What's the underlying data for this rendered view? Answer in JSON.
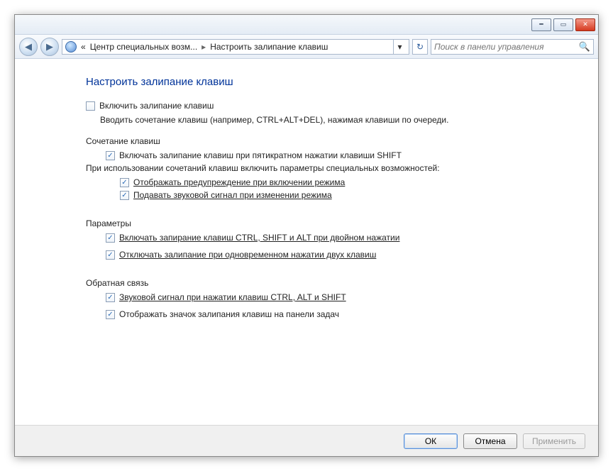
{
  "window": {
    "minimize_glyph": "━",
    "maximize_glyph": "▭",
    "close_glyph": "✕"
  },
  "nav": {
    "back_glyph": "◀",
    "forward_glyph": "▶",
    "crumb_prefix": "«",
    "crumb1": "Центр специальных возм...",
    "crumb2": "Настроить залипание клавиш",
    "sep": "▸",
    "dropdown_glyph": "▾",
    "refresh_glyph": "↻",
    "search_placeholder": "Поиск в панели управления",
    "search_glyph": "🔍"
  },
  "page": {
    "title": "Настроить залипание клавиш",
    "enable_label": "Включить залипание клавиш",
    "enable_desc": "Вводить сочетание клавиш (например, CTRL+ALT+DEL), нажимая клавиши по очереди.",
    "section_shortcut": "Сочетание клавиш",
    "shortcut_enable": "Включать залипание клавиш при пятикратном нажатии клавиши SHIFT",
    "shortcut_note": "При использовании сочетаний клавиш включить параметры специальных возможностей:",
    "show_warning": "Отображать предупреждение при включении режима",
    "play_sound": "Подавать звуковой сигнал при изменении режима",
    "section_params": "Параметры",
    "lock_modifier": "Включать запирание клавиш CTRL, SHIFT и ALT при двойном нажатии",
    "turn_off_two": "Отключать залипание при одновременном нажатии двух клавиш",
    "section_feedback": "Обратная связь",
    "beep_modifier": "Звуковой сигнал при нажатии клавиш CTRL, ALT и SHIFT",
    "show_tray_icon": "Отображать значок залипания клавиш на панели задач"
  },
  "buttons": {
    "ok": "ОК",
    "cancel": "Отмена",
    "apply": "Применить"
  },
  "checks": {
    "enable": false,
    "shortcut_enable": true,
    "show_warning": true,
    "play_sound": true,
    "lock_modifier": true,
    "turn_off_two": true,
    "beep_modifier": true,
    "show_tray_icon": true
  }
}
